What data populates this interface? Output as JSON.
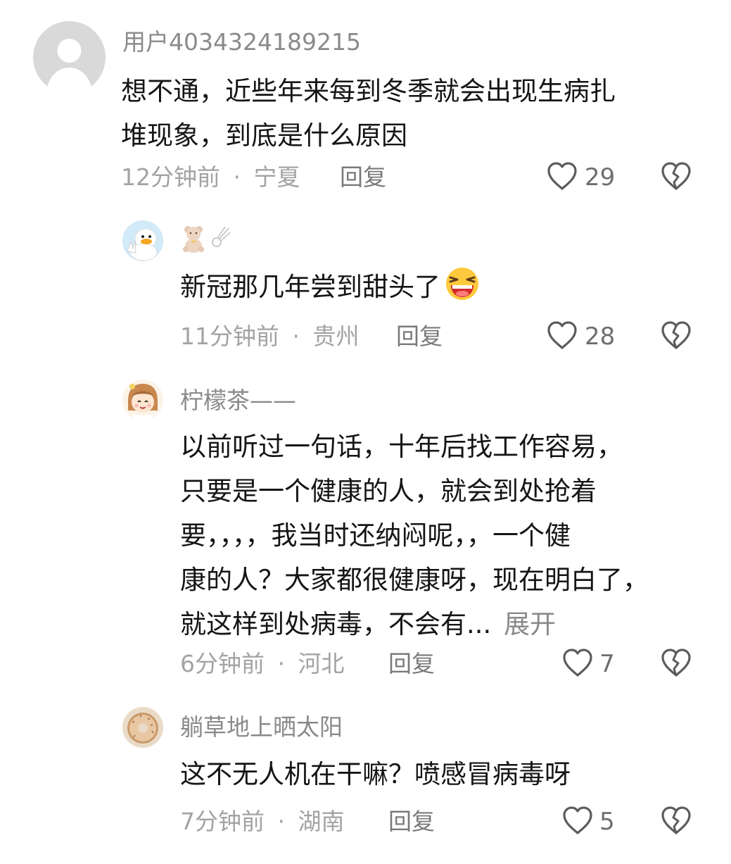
{
  "comments": [
    {
      "username": "用户4034324189215",
      "lines": [
        "想不通，近些年来每到冬季就会出现生病扎",
        "堆现象，到底是什么原因"
      ],
      "time": "12分钟前",
      "location": "宁夏",
      "reply_label": "回复",
      "likes": "29",
      "avatar_icon": "default-avatar-icon"
    },
    {
      "username_icons": [
        "teddy-bear-icon",
        "comet-icon"
      ],
      "lines": [
        "新冠那几年尝到甜头了"
      ],
      "emoji": "laughing-face-emoji",
      "time": "11分钟前",
      "location": "贵州",
      "reply_label": "回复",
      "likes": "28",
      "avatar_icon": "duck-avatar-icon"
    },
    {
      "username": "柠檬茶——",
      "lines": [
        "以前听过一句话，十年后找工作容易，",
        "只要是一个健康的人，就会到处抢着",
        "要，，，，我当时还纳闷呢，，一个健",
        "康的人？大家都很健康呀，现在明白了，",
        "就这样到处病毒，不会有..."
      ],
      "expand_label": "展开",
      "time": "6分钟前",
      "location": "河北",
      "reply_label": "回复",
      "likes": "7",
      "avatar_icon": "cartoon-girl-avatar-icon"
    },
    {
      "username": "躺草地上晒太阳",
      "lines": [
        "这不无人机在干嘛？喷感冒病毒呀"
      ],
      "time": "7分钟前",
      "location": "湖南",
      "reply_label": "回复",
      "likes": "5",
      "avatar_icon": "donut-avatar-icon"
    }
  ],
  "separator": "·",
  "icons": {
    "like": "heart-outline-icon",
    "dislike": "broken-heart-icon"
  },
  "colors": {
    "text": "#151515",
    "meta": "#a3a3a3",
    "username": "#8a8a8a"
  }
}
